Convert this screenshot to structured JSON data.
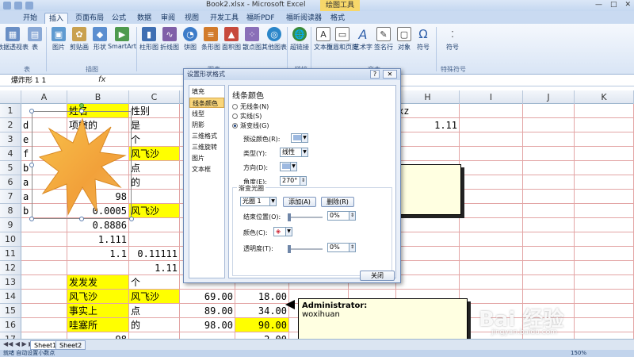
{
  "window": {
    "title": "Book2.xlsx - Microsoft Excel",
    "context_tool": "绘图工具",
    "buttons": [
      "—",
      "□",
      "✕"
    ]
  },
  "tabs": [
    "开始",
    "插入",
    "页面布局",
    "公式",
    "数据",
    "审阅",
    "视图",
    "开发工具",
    "福昕PDF",
    "福昕阅读器",
    "格式"
  ],
  "active_tab": "插入",
  "ribbon": {
    "buttons": [
      "数据透视表",
      "表",
      "图片",
      "剪贴画",
      "形状",
      "SmartArt",
      "柱形图",
      "折线图",
      "饼图",
      "条形图",
      "面积图",
      "散点图",
      "其他图表",
      "超链接",
      "文本框",
      "页眉和页脚",
      "艺术字",
      "签名行",
      "对象",
      "符号",
      "符号"
    ],
    "groups": [
      "表",
      "插图",
      "图表",
      "链接",
      "文本",
      "特殊符号"
    ]
  },
  "formula_bar": {
    "name_box": "爆炸形 1 1",
    "fx": "fx"
  },
  "sheet": {
    "columns": [
      "A",
      "B",
      "C",
      "D",
      "E",
      "F",
      "G",
      "H",
      "I",
      "J",
      "K"
    ],
    "rows": [
      {
        "n": "1",
        "A": "",
        "B": "姓名",
        "C": "性别",
        "H": "xz"
      },
      {
        "n": "2",
        "A": "d",
        "B": "项嫩的",
        "C": "是",
        "H": "1.11"
      },
      {
        "n": "3",
        "A": "e",
        "B": "",
        "C": "个"
      },
      {
        "n": "4",
        "A": "f",
        "B": "",
        "C": "风飞沙"
      },
      {
        "n": "5",
        "A": "b",
        "B": "",
        "C": "点"
      },
      {
        "n": "6",
        "A": "a",
        "B": "",
        "C": "的"
      },
      {
        "n": "7",
        "A": "a",
        "B": "98",
        "C": ""
      },
      {
        "n": "8",
        "A": "b",
        "B": "0.0005",
        "C": "风飞沙"
      },
      {
        "n": "9",
        "A": "",
        "B": "0.8886",
        "C": ""
      },
      {
        "n": "10",
        "A": "",
        "B": "1.111",
        "C": ""
      },
      {
        "n": "11",
        "A": "",
        "B": "1.1",
        "C": "0.11111"
      },
      {
        "n": "12",
        "A": "",
        "B": "",
        "C": "1.11"
      },
      {
        "n": "13",
        "A": "",
        "B": "发发发",
        "C": "个"
      },
      {
        "n": "14",
        "A": "",
        "B": "风飞沙",
        "C": "风飞沙",
        "D": "69.00",
        "E": "18.00"
      },
      {
        "n": "15",
        "A": "",
        "B": "事实上",
        "C": "点",
        "D": "89.00",
        "E": "34.00"
      },
      {
        "n": "16",
        "A": "",
        "B": "哇塞所",
        "C": "的",
        "D": "98.00",
        "E": "90.00"
      },
      {
        "n": "17",
        "A": "",
        "B": "98",
        "C": "",
        "D": "",
        "E": "2.00"
      }
    ]
  },
  "comment": {
    "author": "Administrator:",
    "text": "woxihuan"
  },
  "dialog": {
    "title": "设置形状格式",
    "help": "?",
    "close": "✕",
    "nav": [
      "填充",
      "线条颜色",
      "线型",
      "阴影",
      "三维格式",
      "三维旋转",
      "图片",
      "文本框"
    ],
    "selected_nav": "线条颜色",
    "heading": "线条颜色",
    "radios": [
      "无线条(N)",
      "实线(S)",
      "渐变线(G)"
    ],
    "selected_radio": "渐变线(G)",
    "preset_label": "预设颜色(R):",
    "type_label": "类型(Y):",
    "type_value": "线性",
    "direction_label": "方向(D):",
    "angle_label": "角度(E):",
    "angle_value": "270°",
    "stops_label": "渐变光圈",
    "stop_value": "光圈 1",
    "add_button": "添加(A)",
    "delete_button": "删除(R)",
    "end_pos_label": "结束位置(O):",
    "end_pos_value": "0%",
    "color_label": "颜色(C):",
    "transparency_label": "透明度(T):",
    "transparency_value": "0%",
    "close_button": "关闭"
  },
  "sheet_tabs": [
    "Sheet1",
    "Sheet2"
  ],
  "status": {
    "left": "就绪  自动设置小数点",
    "zoom": "150%"
  },
  "watermark": {
    "text": "Bai 经验",
    "sub": "jingyan.baidu.com"
  }
}
